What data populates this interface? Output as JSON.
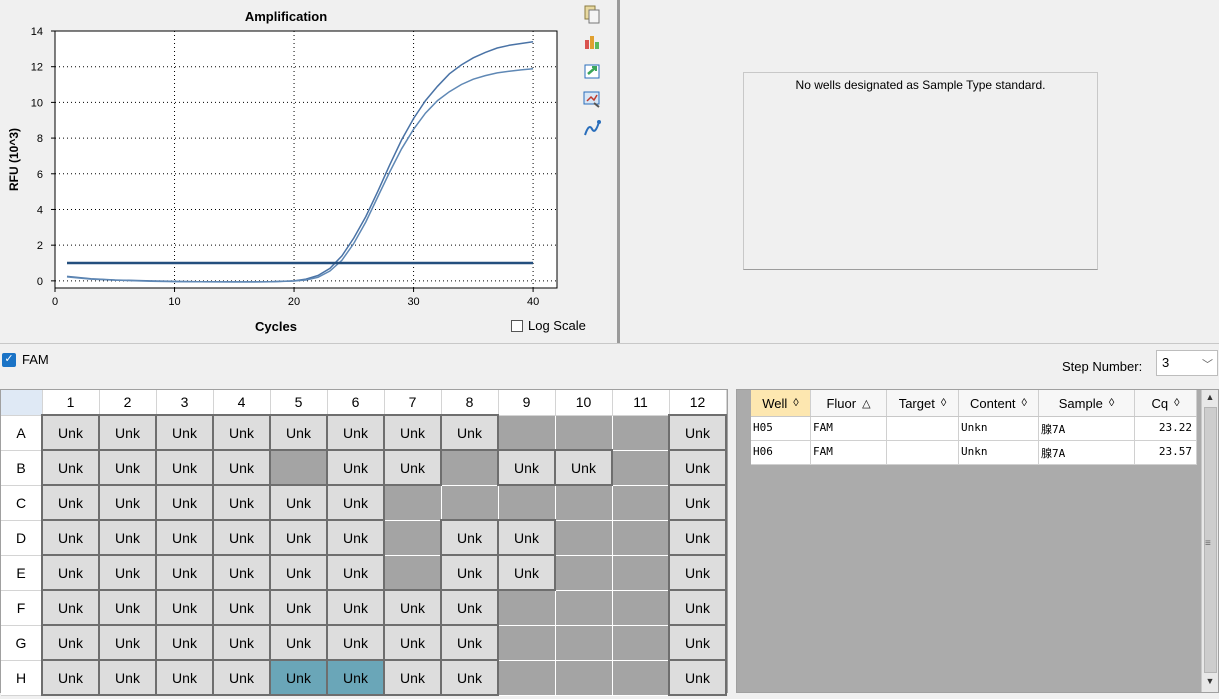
{
  "chart_data": {
    "type": "line",
    "title": "Amplification",
    "xlabel": "Cycles",
    "ylabel": "RFU (10^3)",
    "xlim": [
      0,
      42
    ],
    "ylim": [
      -0.4,
      14
    ],
    "xticks": [
      0,
      10,
      20,
      30,
      40
    ],
    "yticks": [
      0,
      2,
      4,
      6,
      8,
      10,
      12,
      14
    ],
    "grid": true,
    "series": [
      {
        "color": "#4a73a6",
        "x": [
          1,
          3,
          5,
          8,
          10,
          12,
          15,
          18,
          20,
          21,
          22,
          23,
          24,
          25,
          26,
          27,
          28,
          29,
          30,
          31,
          32,
          33,
          34,
          35,
          36,
          37,
          38,
          39,
          40
        ],
        "y": [
          0.25,
          0.12,
          0.05,
          0.0,
          -0.03,
          -0.05,
          -0.06,
          -0.05,
          0.0,
          0.1,
          0.3,
          0.7,
          1.4,
          2.4,
          3.6,
          5.0,
          6.5,
          7.9,
          9.1,
          10.1,
          10.9,
          11.6,
          12.1,
          12.5,
          12.8,
          13.05,
          13.2,
          13.3,
          13.4
        ]
      },
      {
        "color": "#5f88b5",
        "x": [
          1,
          3,
          5,
          8,
          10,
          12,
          15,
          18,
          20,
          21,
          22,
          23,
          24,
          25,
          26,
          27,
          28,
          29,
          30,
          31,
          32,
          33,
          34,
          35,
          36,
          37,
          38,
          39,
          40
        ],
        "y": [
          0.22,
          0.1,
          0.04,
          -0.02,
          -0.04,
          -0.05,
          -0.06,
          -0.05,
          -0.01,
          0.05,
          0.2,
          0.55,
          1.15,
          2.1,
          3.3,
          4.7,
          6.1,
          7.4,
          8.5,
          9.4,
          10.1,
          10.6,
          11.0,
          11.3,
          11.5,
          11.65,
          11.75,
          11.82,
          11.88
        ]
      },
      {
        "color": "#244f7e",
        "x": [
          1,
          40
        ],
        "y": [
          1.0,
          1.0
        ]
      }
    ]
  },
  "log_scale_label": "Log Scale",
  "standard_message": "No wells designated as Sample Type standard.",
  "fluor": {
    "label": "FAM",
    "checked": true
  },
  "step": {
    "label": "Step Number:",
    "value": "3"
  },
  "plate": {
    "columns": [
      "1",
      "2",
      "3",
      "4",
      "5",
      "6",
      "7",
      "8",
      "9",
      "10",
      "11",
      "12"
    ],
    "rows": [
      {
        "label": "A",
        "cells": [
          "Unk",
          "Unk",
          "Unk",
          "Unk",
          "Unk",
          "Unk",
          "Unk",
          "Unk",
          "",
          "",
          "",
          "Unk"
        ]
      },
      {
        "label": "B",
        "cells": [
          "Unk",
          "Unk",
          "Unk",
          "Unk",
          "",
          "Unk",
          "Unk",
          "",
          "Unk",
          "Unk",
          "",
          "Unk"
        ]
      },
      {
        "label": "C",
        "cells": [
          "Unk",
          "Unk",
          "Unk",
          "Unk",
          "Unk",
          "Unk",
          "",
          "",
          "",
          "",
          "",
          "Unk"
        ]
      },
      {
        "label": "D",
        "cells": [
          "Unk",
          "Unk",
          "Unk",
          "Unk",
          "Unk",
          "Unk",
          "",
          "Unk",
          "Unk",
          "",
          "",
          "Unk"
        ]
      },
      {
        "label": "E",
        "cells": [
          "Unk",
          "Unk",
          "Unk",
          "Unk",
          "Unk",
          "Unk",
          "",
          "Unk",
          "Unk",
          "",
          "",
          "Unk"
        ]
      },
      {
        "label": "F",
        "cells": [
          "Unk",
          "Unk",
          "Unk",
          "Unk",
          "Unk",
          "Unk",
          "Unk",
          "Unk",
          "",
          "",
          "",
          "Unk"
        ]
      },
      {
        "label": "G",
        "cells": [
          "Unk",
          "Unk",
          "Unk",
          "Unk",
          "Unk",
          "Unk",
          "Unk",
          "Unk",
          "",
          "",
          "",
          "Unk"
        ]
      },
      {
        "label": "H",
        "cells": [
          "Unk",
          "Unk",
          "Unk",
          "Unk",
          "Unk",
          "Unk",
          "Unk",
          "Unk",
          "",
          "",
          "",
          "Unk"
        ]
      }
    ],
    "selected": [
      "H5",
      "H6"
    ]
  },
  "results": {
    "headers": [
      {
        "label": "Well",
        "sort": "◊"
      },
      {
        "label": "Fluor",
        "sort": "△"
      },
      {
        "label": "Target",
        "sort": "◊"
      },
      {
        "label": "Content",
        "sort": "◊"
      },
      {
        "label": "Sample",
        "sort": "◊"
      },
      {
        "label": "Cq",
        "sort": "◊"
      }
    ],
    "rows": [
      [
        "H05",
        "FAM",
        "",
        "Unkn",
        "腺7A",
        "23.22"
      ],
      [
        "H06",
        "FAM",
        "",
        "Unkn",
        "腺7A",
        "23.57"
      ]
    ]
  },
  "colors": {
    "accent": "#1a73c6",
    "selected_well": "#6aa6b8",
    "empty_well": "#a4a4a4",
    "header_active": "#fde7b0"
  }
}
